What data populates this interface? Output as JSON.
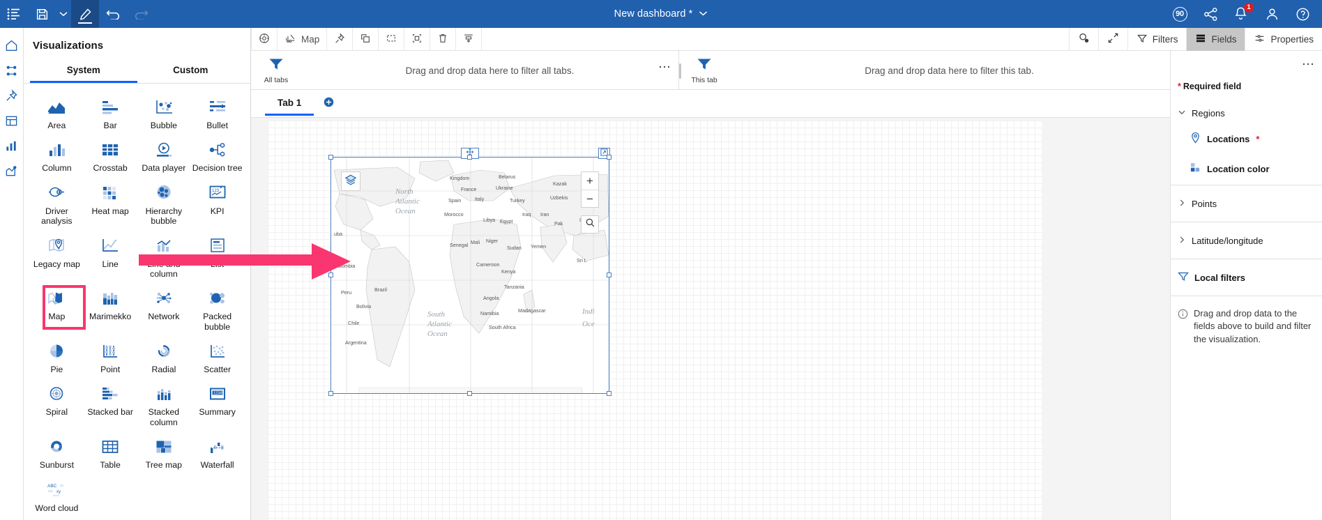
{
  "topbar": {
    "menu_icon": "list-menu-icon",
    "save_icon": "save-icon",
    "save_caret_icon": "chevron-down-icon",
    "edit_icon": "pencil-edit-icon",
    "undo_icon": "undo-icon",
    "redo_icon": "redo-icon",
    "title": "New dashboard *",
    "title_caret_icon": "chevron-down-icon",
    "trial_badge": "90",
    "share_icon": "share-icon",
    "notifications_icon": "bell-icon",
    "notifications_count": "1",
    "account_icon": "user-icon",
    "help_icon": "help-circle-icon"
  },
  "rail": {
    "items": [
      {
        "name": "home-icon"
      },
      {
        "name": "sources-icon"
      },
      {
        "name": "pin-icon"
      },
      {
        "name": "widgets-icon"
      },
      {
        "name": "charts-icon"
      },
      {
        "name": "explore-icon"
      }
    ]
  },
  "visualizations": {
    "title": "Visualizations",
    "tabs": [
      {
        "label": "System",
        "active": true
      },
      {
        "label": "Custom",
        "active": false
      }
    ],
    "items": [
      {
        "label": "Area",
        "icon": "area-chart-icon",
        "highlighted": false
      },
      {
        "label": "Bar",
        "icon": "bar-chart-icon",
        "highlighted": false
      },
      {
        "label": "Bubble",
        "icon": "bubble-chart-icon",
        "highlighted": false
      },
      {
        "label": "Bullet",
        "icon": "bullet-chart-icon",
        "highlighted": false
      },
      {
        "label": "Column",
        "icon": "column-chart-icon",
        "highlighted": false
      },
      {
        "label": "Crosstab",
        "icon": "crosstab-icon",
        "highlighted": false
      },
      {
        "label": "Data player",
        "icon": "data-player-icon",
        "highlighted": false
      },
      {
        "label": "Decision tree",
        "icon": "decision-tree-icon",
        "highlighted": false
      },
      {
        "label": "Driver analysis",
        "icon": "driver-analysis-icon",
        "highlighted": false
      },
      {
        "label": "Heat map",
        "icon": "heat-map-icon",
        "highlighted": false
      },
      {
        "label": "Hierarchy bubble",
        "icon": "hierarchy-bubble-icon",
        "highlighted": false
      },
      {
        "label": "KPI",
        "icon": "kpi-icon",
        "highlighted": false
      },
      {
        "label": "Legacy map",
        "icon": "legacy-map-icon",
        "highlighted": false
      },
      {
        "label": "Line",
        "icon": "line-chart-icon",
        "highlighted": false
      },
      {
        "label": "Line and column",
        "icon": "line-and-column-icon",
        "highlighted": false
      },
      {
        "label": "List",
        "icon": "list-icon",
        "highlighted": false
      },
      {
        "label": "Map",
        "icon": "map-icon",
        "highlighted": true
      },
      {
        "label": "Marimekko",
        "icon": "marimekko-icon",
        "highlighted": false
      },
      {
        "label": "Network",
        "icon": "network-icon",
        "highlighted": false
      },
      {
        "label": "Packed bubble",
        "icon": "packed-bubble-icon",
        "highlighted": false
      },
      {
        "label": "Pie",
        "icon": "pie-chart-icon",
        "highlighted": false
      },
      {
        "label": "Point",
        "icon": "point-chart-icon",
        "highlighted": false
      },
      {
        "label": "Radial",
        "icon": "radial-chart-icon",
        "highlighted": false
      },
      {
        "label": "Scatter",
        "icon": "scatter-chart-icon",
        "highlighted": false
      },
      {
        "label": "Spiral",
        "icon": "spiral-chart-icon",
        "highlighted": false
      },
      {
        "label": "Stacked bar",
        "icon": "stacked-bar-icon",
        "highlighted": false
      },
      {
        "label": "Stacked column",
        "icon": "stacked-column-icon",
        "highlighted": false
      },
      {
        "label": "Summary",
        "icon": "summary-icon",
        "highlighted": false
      },
      {
        "label": "Sunburst",
        "icon": "sunburst-icon",
        "highlighted": false
      },
      {
        "label": "Table",
        "icon": "table-icon",
        "highlighted": false
      },
      {
        "label": "Tree map",
        "icon": "tree-map-icon",
        "highlighted": false
      },
      {
        "label": "Waterfall",
        "icon": "waterfall-icon",
        "highlighted": false
      },
      {
        "label": "Word cloud",
        "icon": "word-cloud-icon",
        "highlighted": false
      }
    ]
  },
  "canvas_toolbar": {
    "left": [
      {
        "name": "target-icon",
        "label": ""
      },
      {
        "name": "chart-type-icon",
        "label": "Map"
      },
      {
        "name": "pin-icon",
        "label": ""
      },
      {
        "name": "copy-icon",
        "label": ""
      },
      {
        "name": "select-icon",
        "label": ""
      },
      {
        "name": "group-icon",
        "label": ""
      },
      {
        "name": "delete-trash-icon",
        "label": ""
      },
      {
        "name": "distribute-icon",
        "label": ""
      }
    ],
    "right": [
      {
        "name": "zoom-out-icon",
        "label": ""
      },
      {
        "name": "expand-icon",
        "label": ""
      },
      {
        "name": "filter-icon",
        "label": "Filters",
        "active": false
      },
      {
        "name": "fields-icon",
        "label": "Fields",
        "active": true
      },
      {
        "name": "properties-icon",
        "label": "Properties",
        "active": false
      }
    ]
  },
  "filter_zones": {
    "all_tabs": {
      "icon": "filter-funnel-icon",
      "icon_label": "All tabs",
      "text": "Drag and drop data here to filter all tabs.",
      "overflow_icon": "overflow-menu-icon"
    },
    "this_tab": {
      "icon": "filter-funnel-icon",
      "icon_label": "This tab",
      "text": "Drag and drop data here to filter this tab.",
      "overflow_icon": "overflow-menu-icon"
    }
  },
  "tabs": {
    "items": [
      {
        "label": "Tab 1",
        "active": true
      }
    ],
    "add_icon": "add-circle-icon"
  },
  "map_widget": {
    "drag_handle_icon": "move-handle-icon",
    "expand_handle_icon": "expand-widget-icon",
    "layers_icon": "layers-icon",
    "zoom_in_label": "+",
    "zoom_out_label": "−",
    "search_icon": "search-icon",
    "ocean_labels": [
      "North Atlantic Ocean",
      "South Atlantic Ocean",
      "Indian Ocean"
    ],
    "country_labels": [
      "Kingdom",
      "Belarus",
      "France",
      "Ukraine",
      "Kazak",
      "Spain",
      "Italy",
      "Uzbekis",
      "Turkey",
      "Morocco",
      "Libya",
      "Egypt",
      "Iraq",
      "Iran",
      "Pak",
      "Indi",
      "Mali",
      "Niger",
      "Sudan",
      "Yemen",
      "Senegal",
      "uba",
      "Colombia",
      "Cameroon",
      "Sri L",
      "Kenya",
      "Peru",
      "Brazil",
      "Tanzania",
      "Bolivia",
      "Angola",
      "Namibia",
      "Madagascar",
      "Chile",
      "South Africa",
      "Argentina"
    ]
  },
  "right_panel": {
    "overflow_icon": "overflow-menu-icon",
    "required_note": "Required field",
    "required_star": "*",
    "sections": [
      {
        "label": "Regions",
        "expanded": true,
        "chevron": "chevron-down-icon"
      },
      {
        "label": "Points",
        "expanded": false,
        "chevron": "chevron-right-icon"
      },
      {
        "label": "Latitude/longitude",
        "expanded": false,
        "chevron": "chevron-right-icon"
      }
    ],
    "region_fields": [
      {
        "label": "Locations",
        "required": true,
        "icon": "location-pin-icon"
      },
      {
        "label": "Location color",
        "required": false,
        "icon": "color-swatch-icon"
      }
    ],
    "local_filters": {
      "label": "Local filters",
      "icon": "filter-funnel-icon"
    },
    "hint": {
      "icon": "info-circle-icon",
      "text": "Drag and drop data to the fields above to build and filter the visualization."
    }
  },
  "colors": {
    "brand_blue": "#2160ad",
    "accent_blue": "#0f62fe",
    "icon_blue": "#1f63b0",
    "icon_blue_light": "#a7c2e6",
    "highlight_pink": "#f9366f",
    "danger_red": "#da1e28"
  }
}
